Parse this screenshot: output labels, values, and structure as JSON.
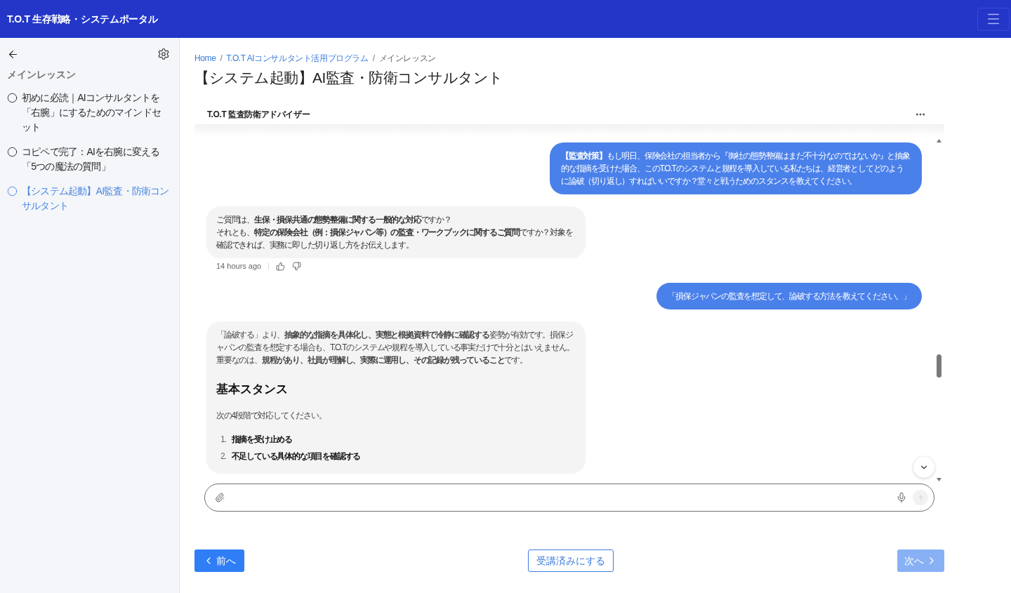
{
  "header": {
    "title": "T.O.T 生存戦略・システムポータル"
  },
  "sidebar": {
    "section_title": "メインレッスン",
    "items": [
      {
        "label": "初めに必読｜AIコンサルタントを「右腕」にするためのマインドセット",
        "selected": false,
        "done": false
      },
      {
        "label": "コピペで完了：AIを右腕に変える「5つの魔法の質問」",
        "selected": false,
        "done": false
      },
      {
        "label": "【システム起動】AI監査・防衛コンサルタント",
        "selected": true,
        "done": false
      }
    ]
  },
  "breadcrumb": {
    "separator": "/",
    "items": [
      {
        "label": "Home",
        "kind": "link"
      },
      {
        "label": "T.O.T AIコンサルタント活用プログラム",
        "kind": "link"
      },
      {
        "label": "メインレッスン",
        "kind": "current"
      }
    ]
  },
  "page_title": "【システム起動】AI監査・防衛コンサルタント",
  "chat": {
    "title": "T.O.T 監査防衛アドバイザー",
    "messages": [
      {
        "kind": "user",
        "text": "**【監査対策】**もし明日、保険会社の担当者から『御社の態勢整備はまだ不十分なのではないか』と抽象的な指摘を受けた場合、このT.O.Tのシステムと規程を導入している私たちは、経営者としてどのように論破（切り返し）すればいいですか？堂々と戦うためのスタンスを教えてください。"
      },
      {
        "kind": "assistant",
        "blocks": [
          {
            "kind": "line",
            "text": "ご質問は、**生保・損保共通の態勢整備に関する一般的な対応**ですか？"
          },
          {
            "kind": "line",
            "text": "それとも、**特定の保険会社（例：損保ジャパン等）の監査・ワークブックに関するご質問**ですか？対象を確認できれば、実務に即した切り返し方をお伝えします。"
          }
        ],
        "time": "14 hours ago"
      },
      {
        "kind": "user",
        "text": "「損保ジャパンの監査を想定して、論破する方法を教えてください。」"
      },
      {
        "kind": "assistant",
        "blocks": [
          {
            "kind": "paragraph",
            "text": "「論破する」より、**抽象的な指摘を具体化し、実態と根拠資料で冷静に確認する**姿勢が有効です。損保ジャパンの監査を想定する場合も、T.O.Tのシステムや規程を導入している事実だけで十分とはいえません。重要なのは、**規程があり、社員が理解し、実際に運用し、その記録が残っていること**です。"
          },
          {
            "kind": "heading",
            "text": "基本スタンス"
          },
          {
            "kind": "paragraph",
            "text": "次の4段階で対応してください。"
          },
          {
            "kind": "list_item",
            "number": "1.",
            "text": "指摘を受け止める"
          },
          {
            "kind": "list_item",
            "number": "2.",
            "text": "不足している具体的な項目を確認する"
          }
        ]
      }
    ],
    "send_button": {
      "disabled": true
    }
  },
  "nav": {
    "prev": {
      "label": "前へ",
      "disabled": false
    },
    "complete": {
      "label": "受講済みにする"
    },
    "next": {
      "label": "次へ",
      "disabled": true
    }
  }
}
